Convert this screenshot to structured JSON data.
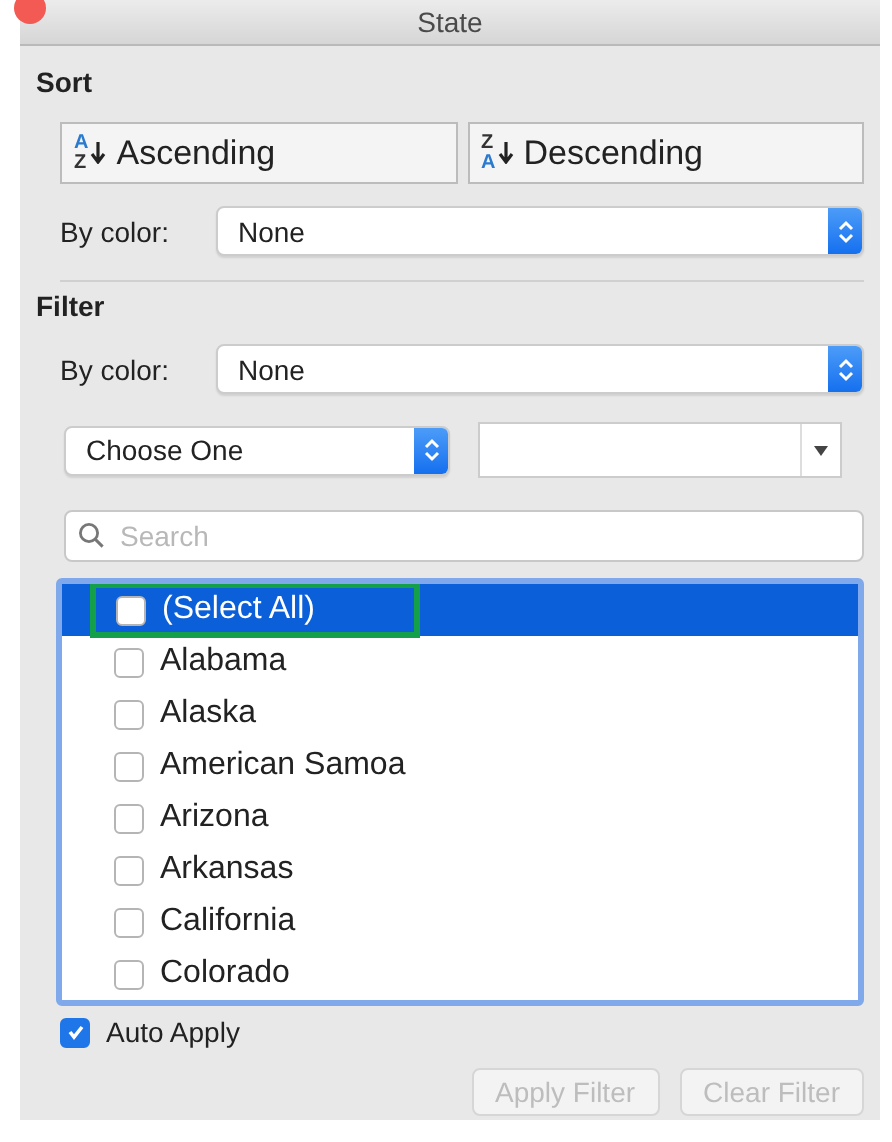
{
  "window": {
    "title": "State"
  },
  "sort": {
    "heading": "Sort",
    "buttons": [
      {
        "kind": "ascending",
        "label": "Ascending",
        "icon_top": "A",
        "icon_bottom": "Z"
      },
      {
        "kind": "descending",
        "label": "Descending",
        "icon_top": "Z",
        "icon_bottom": "A"
      }
    ],
    "by_color": {
      "label": "By color:",
      "value": "None"
    }
  },
  "filter": {
    "heading": "Filter",
    "by_color": {
      "label": "By color:",
      "value": "None"
    },
    "condition": {
      "value": "Choose One"
    },
    "search": {
      "placeholder": "Search"
    },
    "items": [
      {
        "label": "(Select All)",
        "checked": false,
        "selected": true,
        "highlighted": true
      },
      {
        "label": "Alabama",
        "checked": false,
        "selected": false,
        "highlighted": false
      },
      {
        "label": "Alaska",
        "checked": false,
        "selected": false,
        "highlighted": false
      },
      {
        "label": "American Samoa",
        "checked": false,
        "selected": false,
        "highlighted": false
      },
      {
        "label": "Arizona",
        "checked": false,
        "selected": false,
        "highlighted": false
      },
      {
        "label": "Arkansas",
        "checked": false,
        "selected": false,
        "highlighted": false
      },
      {
        "label": "California",
        "checked": false,
        "selected": false,
        "highlighted": false
      },
      {
        "label": "Colorado",
        "checked": false,
        "selected": false,
        "highlighted": false
      }
    ],
    "auto_apply": {
      "label": "Auto Apply",
      "checked": true
    },
    "buttons": [
      {
        "label": "Apply Filter",
        "disabled": true
      },
      {
        "label": "Clear Filter",
        "disabled": true
      }
    ]
  }
}
